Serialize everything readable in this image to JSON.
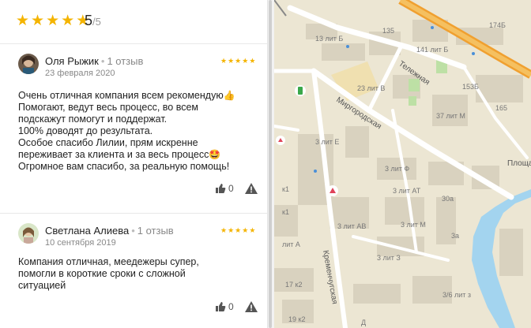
{
  "rating": {
    "stars": 5,
    "score": "5",
    "max": "/5"
  },
  "reviews": [
    {
      "author": "Оля Рыжик",
      "count": "1 отзыв",
      "date": "23 февраля 2020",
      "stars": 5,
      "lines": [
        "Очень отличная компания всем рекомендую",
        "Помогают, ведут весь процесс, во всем",
        "подскажут помогут и поддержат.",
        "100% доводят до результата.",
        "Особое спасибо Лилии, прям искренне",
        "переживает за клиента и за весь процесс",
        "Огромное вам спасибо, за реальную помощь!"
      ],
      "likes": "0"
    },
    {
      "author": "Светлана Алиева",
      "count": "1 отзыв",
      "date": "10 сентября 2019",
      "stars": 5,
      "lines": [
        "Компания отличная, меедежеры супер,",
        "помогли в короткие сроки с сложной",
        "ситуацией"
      ],
      "likes": "0"
    }
  ],
  "map": {
    "streets": [
      "Тележная",
      "Миргородская",
      "Кременчугская",
      "Площа"
    ],
    "buildings": [
      "135",
      "13 лит Б",
      "174Б",
      "141 лит Б",
      "23 лит В",
      "153Б",
      "37 лит М",
      "165",
      "3 лит Е",
      "3 лит Ф",
      "3 лит АТ",
      "30а",
      "3 лит АВ",
      "3 лит М",
      "3а",
      "3 лит З",
      "3/6 лит з",
      "17 к2",
      "19 к2",
      "к1",
      "к1",
      "лит А",
      "Д"
    ]
  },
  "colors": {
    "star": "#f4b400",
    "water": "#a3d4ef",
    "highway": "#f0a030",
    "road": "#ffffff"
  }
}
